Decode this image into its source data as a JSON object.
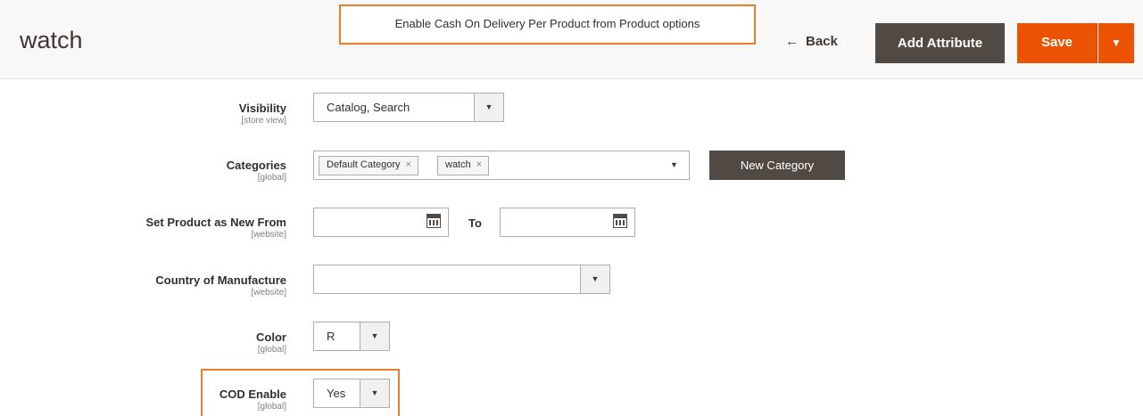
{
  "header": {
    "title": "watch",
    "annotation": "Enable Cash On Delivery Per Product from Product options",
    "back_arrow": "←",
    "back_label": "Back",
    "add_attribute_label": "Add Attribute",
    "save_label": "Save",
    "save_toggle_icon": "▼"
  },
  "fields": {
    "visibility": {
      "label": "Visibility",
      "scope": "[store view]",
      "value": "Catalog, Search"
    },
    "categories": {
      "label": "Categories",
      "scope": "[global]",
      "tags": [
        "Default Category",
        "watch"
      ],
      "remove_icon": "×",
      "new_category_label": "New Category"
    },
    "new_from": {
      "label": "Set Product as New From",
      "scope": "[website]",
      "from_value": "",
      "to_label": "To",
      "to_value": ""
    },
    "country": {
      "label": "Country of Manufacture",
      "scope": "[website]",
      "value": ""
    },
    "color": {
      "label": "Color",
      "scope": "[global]",
      "value": "R"
    },
    "cod_enable": {
      "label": "COD Enable",
      "scope": "[global]",
      "value": "Yes"
    }
  },
  "icons": {
    "dropdown": "▼",
    "calendar": "calendar-icon"
  },
  "colors": {
    "accent": "#eb5202",
    "dark_button": "#514943",
    "highlight": "#eb7d2a"
  }
}
